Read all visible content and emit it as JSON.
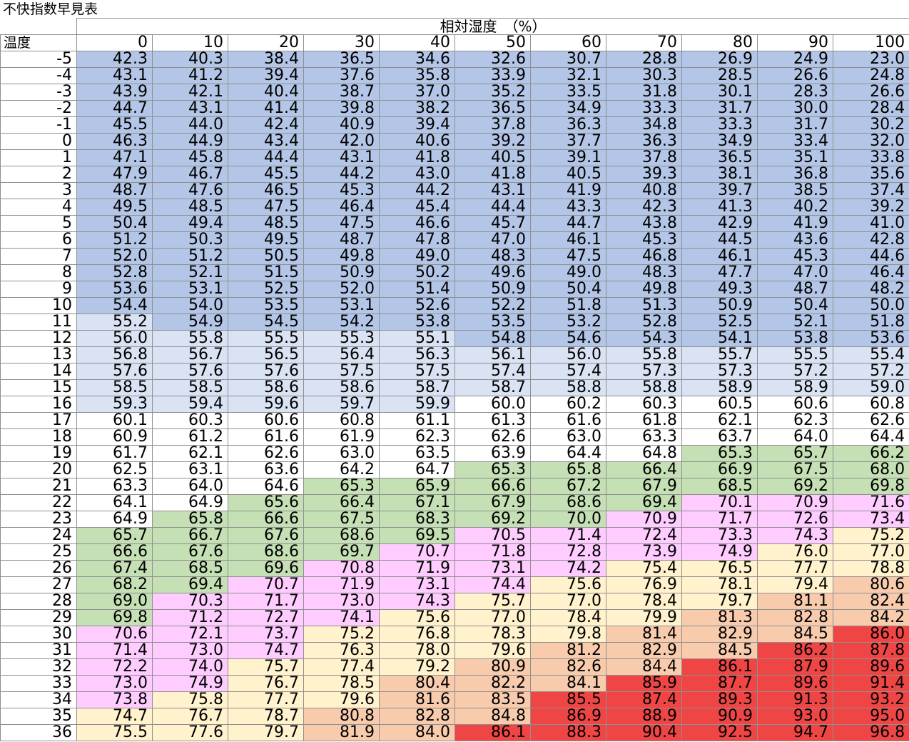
{
  "title": "不快指数早見表",
  "humidity_header": "相対湿度　（%）",
  "temperature_header": "温度",
  "humidity_levels": [
    "0",
    "10",
    "20",
    "30",
    "40",
    "50",
    "60",
    "70",
    "80",
    "90",
    "100"
  ],
  "palette": {
    "blue": "#b4c6e7",
    "lblue": "#dae3f3",
    "white": "#ffffff",
    "green": "#c5e0b4",
    "pink": "#ffccff",
    "cream": "#fff2cc",
    "peach": "#f8cbad",
    "red": "#f04545"
  },
  "rows": [
    {
      "temp": "-5",
      "values": [
        "42.3",
        "40.3",
        "38.4",
        "36.5",
        "34.6",
        "32.6",
        "30.7",
        "28.8",
        "26.9",
        "24.9",
        "23.0"
      ],
      "colors": [
        "blue",
        "blue",
        "blue",
        "blue",
        "blue",
        "blue",
        "blue",
        "blue",
        "blue",
        "blue",
        "blue"
      ]
    },
    {
      "temp": "-4",
      "values": [
        "43.1",
        "41.2",
        "39.4",
        "37.6",
        "35.8",
        "33.9",
        "32.1",
        "30.3",
        "28.5",
        "26.6",
        "24.8"
      ],
      "colors": [
        "blue",
        "blue",
        "blue",
        "blue",
        "blue",
        "blue",
        "blue",
        "blue",
        "blue",
        "blue",
        "blue"
      ]
    },
    {
      "temp": "-3",
      "values": [
        "43.9",
        "42.1",
        "40.4",
        "38.7",
        "37.0",
        "35.2",
        "33.5",
        "31.8",
        "30.1",
        "28.3",
        "26.6"
      ],
      "colors": [
        "blue",
        "blue",
        "blue",
        "blue",
        "blue",
        "blue",
        "blue",
        "blue",
        "blue",
        "blue",
        "blue"
      ]
    },
    {
      "temp": "-2",
      "values": [
        "44.7",
        "43.1",
        "41.4",
        "39.8",
        "38.2",
        "36.5",
        "34.9",
        "33.3",
        "31.7",
        "30.0",
        "28.4"
      ],
      "colors": [
        "blue",
        "blue",
        "blue",
        "blue",
        "blue",
        "blue",
        "blue",
        "blue",
        "blue",
        "blue",
        "blue"
      ]
    },
    {
      "temp": "-1",
      "values": [
        "45.5",
        "44.0",
        "42.4",
        "40.9",
        "39.4",
        "37.8",
        "36.3",
        "34.8",
        "33.3",
        "31.7",
        "30.2"
      ],
      "colors": [
        "blue",
        "blue",
        "blue",
        "blue",
        "blue",
        "blue",
        "blue",
        "blue",
        "blue",
        "blue",
        "blue"
      ]
    },
    {
      "temp": "0",
      "values": [
        "46.3",
        "44.9",
        "43.4",
        "42.0",
        "40.6",
        "39.2",
        "37.7",
        "36.3",
        "34.9",
        "33.4",
        "32.0"
      ],
      "colors": [
        "blue",
        "blue",
        "blue",
        "blue",
        "blue",
        "blue",
        "blue",
        "blue",
        "blue",
        "blue",
        "blue"
      ]
    },
    {
      "temp": "1",
      "values": [
        "47.1",
        "45.8",
        "44.4",
        "43.1",
        "41.8",
        "40.5",
        "39.1",
        "37.8",
        "36.5",
        "35.1",
        "33.8"
      ],
      "colors": [
        "blue",
        "blue",
        "blue",
        "blue",
        "blue",
        "blue",
        "blue",
        "blue",
        "blue",
        "blue",
        "blue"
      ]
    },
    {
      "temp": "2",
      "values": [
        "47.9",
        "46.7",
        "45.5",
        "44.2",
        "43.0",
        "41.8",
        "40.5",
        "39.3",
        "38.1",
        "36.8",
        "35.6"
      ],
      "colors": [
        "blue",
        "blue",
        "blue",
        "blue",
        "blue",
        "blue",
        "blue",
        "blue",
        "blue",
        "blue",
        "blue"
      ]
    },
    {
      "temp": "3",
      "values": [
        "48.7",
        "47.6",
        "46.5",
        "45.3",
        "44.2",
        "43.1",
        "41.9",
        "40.8",
        "39.7",
        "38.5",
        "37.4"
      ],
      "colors": [
        "blue",
        "blue",
        "blue",
        "blue",
        "blue",
        "blue",
        "blue",
        "blue",
        "blue",
        "blue",
        "blue"
      ]
    },
    {
      "temp": "4",
      "values": [
        "49.5",
        "48.5",
        "47.5",
        "46.4",
        "45.4",
        "44.4",
        "43.3",
        "42.3",
        "41.3",
        "40.2",
        "39.2"
      ],
      "colors": [
        "blue",
        "blue",
        "blue",
        "blue",
        "blue",
        "blue",
        "blue",
        "blue",
        "blue",
        "blue",
        "blue"
      ]
    },
    {
      "temp": "5",
      "values": [
        "50.4",
        "49.4",
        "48.5",
        "47.5",
        "46.6",
        "45.7",
        "44.7",
        "43.8",
        "42.9",
        "41.9",
        "41.0"
      ],
      "colors": [
        "blue",
        "blue",
        "blue",
        "blue",
        "blue",
        "blue",
        "blue",
        "blue",
        "blue",
        "blue",
        "blue"
      ]
    },
    {
      "temp": "6",
      "values": [
        "51.2",
        "50.3",
        "49.5",
        "48.7",
        "47.8",
        "47.0",
        "46.1",
        "45.3",
        "44.5",
        "43.6",
        "42.8"
      ],
      "colors": [
        "blue",
        "blue",
        "blue",
        "blue",
        "blue",
        "blue",
        "blue",
        "blue",
        "blue",
        "blue",
        "blue"
      ]
    },
    {
      "temp": "7",
      "values": [
        "52.0",
        "51.2",
        "50.5",
        "49.8",
        "49.0",
        "48.3",
        "47.5",
        "46.8",
        "46.1",
        "45.3",
        "44.6"
      ],
      "colors": [
        "blue",
        "blue",
        "blue",
        "blue",
        "blue",
        "blue",
        "blue",
        "blue",
        "blue",
        "blue",
        "blue"
      ]
    },
    {
      "temp": "8",
      "values": [
        "52.8",
        "52.1",
        "51.5",
        "50.9",
        "50.2",
        "49.6",
        "49.0",
        "48.3",
        "47.7",
        "47.0",
        "46.4"
      ],
      "colors": [
        "blue",
        "blue",
        "blue",
        "blue",
        "blue",
        "blue",
        "blue",
        "blue",
        "blue",
        "blue",
        "blue"
      ]
    },
    {
      "temp": "9",
      "values": [
        "53.6",
        "53.1",
        "52.5",
        "52.0",
        "51.4",
        "50.9",
        "50.4",
        "49.8",
        "49.3",
        "48.7",
        "48.2"
      ],
      "colors": [
        "blue",
        "blue",
        "blue",
        "blue",
        "blue",
        "blue",
        "blue",
        "blue",
        "blue",
        "blue",
        "blue"
      ]
    },
    {
      "temp": "10",
      "values": [
        "54.4",
        "54.0",
        "53.5",
        "53.1",
        "52.6",
        "52.2",
        "51.8",
        "51.3",
        "50.9",
        "50.4",
        "50.0"
      ],
      "colors": [
        "blue",
        "blue",
        "blue",
        "blue",
        "blue",
        "blue",
        "blue",
        "blue",
        "blue",
        "blue",
        "blue"
      ]
    },
    {
      "temp": "11",
      "values": [
        "55.2",
        "54.9",
        "54.5",
        "54.2",
        "53.8",
        "53.5",
        "53.2",
        "52.8",
        "52.5",
        "52.1",
        "51.8"
      ],
      "colors": [
        "lblue",
        "blue",
        "blue",
        "blue",
        "blue",
        "blue",
        "blue",
        "blue",
        "blue",
        "blue",
        "blue"
      ]
    },
    {
      "temp": "12",
      "values": [
        "56.0",
        "55.8",
        "55.5",
        "55.3",
        "55.1",
        "54.8",
        "54.6",
        "54.3",
        "54.1",
        "53.8",
        "53.6"
      ],
      "colors": [
        "lblue",
        "lblue",
        "lblue",
        "lblue",
        "lblue",
        "blue",
        "blue",
        "blue",
        "blue",
        "blue",
        "blue"
      ]
    },
    {
      "temp": "13",
      "values": [
        "56.8",
        "56.7",
        "56.5",
        "56.4",
        "56.3",
        "56.1",
        "56.0",
        "55.8",
        "55.7",
        "55.5",
        "55.4"
      ],
      "colors": [
        "lblue",
        "lblue",
        "lblue",
        "lblue",
        "lblue",
        "lblue",
        "lblue",
        "lblue",
        "lblue",
        "lblue",
        "lblue"
      ]
    },
    {
      "temp": "14",
      "values": [
        "57.6",
        "57.6",
        "57.6",
        "57.5",
        "57.5",
        "57.4",
        "57.4",
        "57.3",
        "57.3",
        "57.2",
        "57.2"
      ],
      "colors": [
        "lblue",
        "lblue",
        "lblue",
        "lblue",
        "lblue",
        "lblue",
        "lblue",
        "lblue",
        "lblue",
        "lblue",
        "lblue"
      ]
    },
    {
      "temp": "15",
      "values": [
        "58.5",
        "58.5",
        "58.6",
        "58.6",
        "58.7",
        "58.7",
        "58.8",
        "58.8",
        "58.9",
        "58.9",
        "59.0"
      ],
      "colors": [
        "lblue",
        "lblue",
        "lblue",
        "lblue",
        "lblue",
        "lblue",
        "lblue",
        "lblue",
        "lblue",
        "lblue",
        "lblue"
      ]
    },
    {
      "temp": "16",
      "values": [
        "59.3",
        "59.4",
        "59.6",
        "59.7",
        "59.9",
        "60.0",
        "60.2",
        "60.3",
        "60.5",
        "60.6",
        "60.8"
      ],
      "colors": [
        "lblue",
        "lblue",
        "lblue",
        "lblue",
        "lblue",
        "white",
        "white",
        "white",
        "white",
        "white",
        "white"
      ]
    },
    {
      "temp": "17",
      "values": [
        "60.1",
        "60.3",
        "60.6",
        "60.8",
        "61.1",
        "61.3",
        "61.6",
        "61.8",
        "62.1",
        "62.3",
        "62.6"
      ],
      "colors": [
        "white",
        "white",
        "white",
        "white",
        "white",
        "white",
        "white",
        "white",
        "white",
        "white",
        "white"
      ]
    },
    {
      "temp": "18",
      "values": [
        "60.9",
        "61.2",
        "61.6",
        "61.9",
        "62.3",
        "62.6",
        "63.0",
        "63.3",
        "63.7",
        "64.0",
        "64.4"
      ],
      "colors": [
        "white",
        "white",
        "white",
        "white",
        "white",
        "white",
        "white",
        "white",
        "white",
        "white",
        "white"
      ]
    },
    {
      "temp": "19",
      "values": [
        "61.7",
        "62.1",
        "62.6",
        "63.0",
        "63.5",
        "63.9",
        "64.4",
        "64.8",
        "65.3",
        "65.7",
        "66.2"
      ],
      "colors": [
        "white",
        "white",
        "white",
        "white",
        "white",
        "white",
        "white",
        "white",
        "green",
        "green",
        "green"
      ]
    },
    {
      "temp": "20",
      "values": [
        "62.5",
        "63.1",
        "63.6",
        "64.2",
        "64.7",
        "65.3",
        "65.8",
        "66.4",
        "66.9",
        "67.5",
        "68.0"
      ],
      "colors": [
        "white",
        "white",
        "white",
        "white",
        "white",
        "green",
        "green",
        "green",
        "green",
        "green",
        "green"
      ]
    },
    {
      "temp": "21",
      "values": [
        "63.3",
        "64.0",
        "64.6",
        "65.3",
        "65.9",
        "66.6",
        "67.2",
        "67.9",
        "68.5",
        "69.2",
        "69.8"
      ],
      "colors": [
        "white",
        "white",
        "white",
        "green",
        "green",
        "green",
        "green",
        "green",
        "green",
        "green",
        "green"
      ]
    },
    {
      "temp": "22",
      "values": [
        "64.1",
        "64.9",
        "65.6",
        "66.4",
        "67.1",
        "67.9",
        "68.6",
        "69.4",
        "70.1",
        "70.9",
        "71.6"
      ],
      "colors": [
        "white",
        "white",
        "green",
        "green",
        "green",
        "green",
        "green",
        "green",
        "pink",
        "pink",
        "pink"
      ]
    },
    {
      "temp": "23",
      "values": [
        "64.9",
        "65.8",
        "66.6",
        "67.5",
        "68.3",
        "69.2",
        "70.0",
        "70.9",
        "71.7",
        "72.6",
        "73.4"
      ],
      "colors": [
        "white",
        "green",
        "green",
        "green",
        "green",
        "green",
        "green",
        "pink",
        "pink",
        "pink",
        "pink"
      ]
    },
    {
      "temp": "24",
      "values": [
        "65.7",
        "66.7",
        "67.6",
        "68.6",
        "69.5",
        "70.5",
        "71.4",
        "72.4",
        "73.3",
        "74.3",
        "75.2"
      ],
      "colors": [
        "green",
        "green",
        "green",
        "green",
        "green",
        "pink",
        "pink",
        "pink",
        "pink",
        "pink",
        "cream"
      ]
    },
    {
      "temp": "25",
      "values": [
        "66.6",
        "67.6",
        "68.6",
        "69.7",
        "70.7",
        "71.8",
        "72.8",
        "73.9",
        "74.9",
        "76.0",
        "77.0"
      ],
      "colors": [
        "green",
        "green",
        "green",
        "green",
        "pink",
        "pink",
        "pink",
        "pink",
        "pink",
        "cream",
        "cream"
      ]
    },
    {
      "temp": "26",
      "values": [
        "67.4",
        "68.5",
        "69.6",
        "70.8",
        "71.9",
        "73.1",
        "74.2",
        "75.4",
        "76.5",
        "77.7",
        "78.8"
      ],
      "colors": [
        "green",
        "green",
        "green",
        "pink",
        "pink",
        "pink",
        "pink",
        "cream",
        "cream",
        "cream",
        "cream"
      ]
    },
    {
      "temp": "27",
      "values": [
        "68.2",
        "69.4",
        "70.7",
        "71.9",
        "73.1",
        "74.4",
        "75.6",
        "76.9",
        "78.1",
        "79.4",
        "80.6"
      ],
      "colors": [
        "green",
        "green",
        "pink",
        "pink",
        "pink",
        "pink",
        "cream",
        "cream",
        "cream",
        "cream",
        "peach"
      ]
    },
    {
      "temp": "28",
      "values": [
        "69.0",
        "70.3",
        "71.7",
        "73.0",
        "74.3",
        "75.7",
        "77.0",
        "78.4",
        "79.7",
        "81.1",
        "82.4"
      ],
      "colors": [
        "green",
        "pink",
        "pink",
        "pink",
        "pink",
        "cream",
        "cream",
        "cream",
        "cream",
        "peach",
        "peach"
      ]
    },
    {
      "temp": "29",
      "values": [
        "69.8",
        "71.2",
        "72.7",
        "74.1",
        "75.6",
        "77.0",
        "78.4",
        "79.9",
        "81.3",
        "82.8",
        "84.2"
      ],
      "colors": [
        "green",
        "pink",
        "pink",
        "pink",
        "cream",
        "cream",
        "cream",
        "cream",
        "peach",
        "peach",
        "peach"
      ]
    },
    {
      "temp": "30",
      "values": [
        "70.6",
        "72.1",
        "73.7",
        "75.2",
        "76.8",
        "78.3",
        "79.8",
        "81.4",
        "82.9",
        "84.5",
        "86.0"
      ],
      "colors": [
        "pink",
        "pink",
        "pink",
        "cream",
        "cream",
        "cream",
        "cream",
        "peach",
        "peach",
        "peach",
        "red"
      ]
    },
    {
      "temp": "31",
      "values": [
        "71.4",
        "73.0",
        "74.7",
        "76.3",
        "78.0",
        "79.6",
        "81.2",
        "82.9",
        "84.5",
        "86.2",
        "87.8"
      ],
      "colors": [
        "pink",
        "pink",
        "pink",
        "cream",
        "cream",
        "cream",
        "peach",
        "peach",
        "peach",
        "red",
        "red"
      ]
    },
    {
      "temp": "32",
      "values": [
        "72.2",
        "74.0",
        "75.7",
        "77.4",
        "79.2",
        "80.9",
        "82.6",
        "84.4",
        "86.1",
        "87.9",
        "89.6"
      ],
      "colors": [
        "pink",
        "pink",
        "cream",
        "cream",
        "cream",
        "peach",
        "peach",
        "peach",
        "red",
        "red",
        "red"
      ]
    },
    {
      "temp": "33",
      "values": [
        "73.0",
        "74.9",
        "76.7",
        "78.5",
        "80.4",
        "82.2",
        "84.1",
        "85.9",
        "87.7",
        "89.6",
        "91.4"
      ],
      "colors": [
        "pink",
        "pink",
        "cream",
        "cream",
        "peach",
        "peach",
        "peach",
        "red",
        "red",
        "red",
        "red"
      ]
    },
    {
      "temp": "34",
      "values": [
        "73.8",
        "75.8",
        "77.7",
        "79.6",
        "81.6",
        "83.5",
        "85.5",
        "87.4",
        "89.3",
        "91.3",
        "93.2"
      ],
      "colors": [
        "pink",
        "cream",
        "cream",
        "cream",
        "peach",
        "peach",
        "red",
        "red",
        "red",
        "red",
        "red"
      ]
    },
    {
      "temp": "35",
      "values": [
        "74.7",
        "76.7",
        "78.7",
        "80.8",
        "82.8",
        "84.8",
        "86.9",
        "88.9",
        "90.9",
        "93.0",
        "95.0"
      ],
      "colors": [
        "cream",
        "cream",
        "cream",
        "peach",
        "peach",
        "peach",
        "red",
        "red",
        "red",
        "red",
        "red"
      ]
    },
    {
      "temp": "36",
      "values": [
        "75.5",
        "77.6",
        "79.7",
        "81.9",
        "84.0",
        "86.1",
        "88.3",
        "90.4",
        "92.5",
        "94.7",
        "96.8"
      ],
      "colors": [
        "cream",
        "cream",
        "cream",
        "peach",
        "peach",
        "red",
        "red",
        "red",
        "red",
        "red",
        "red"
      ]
    }
  ]
}
